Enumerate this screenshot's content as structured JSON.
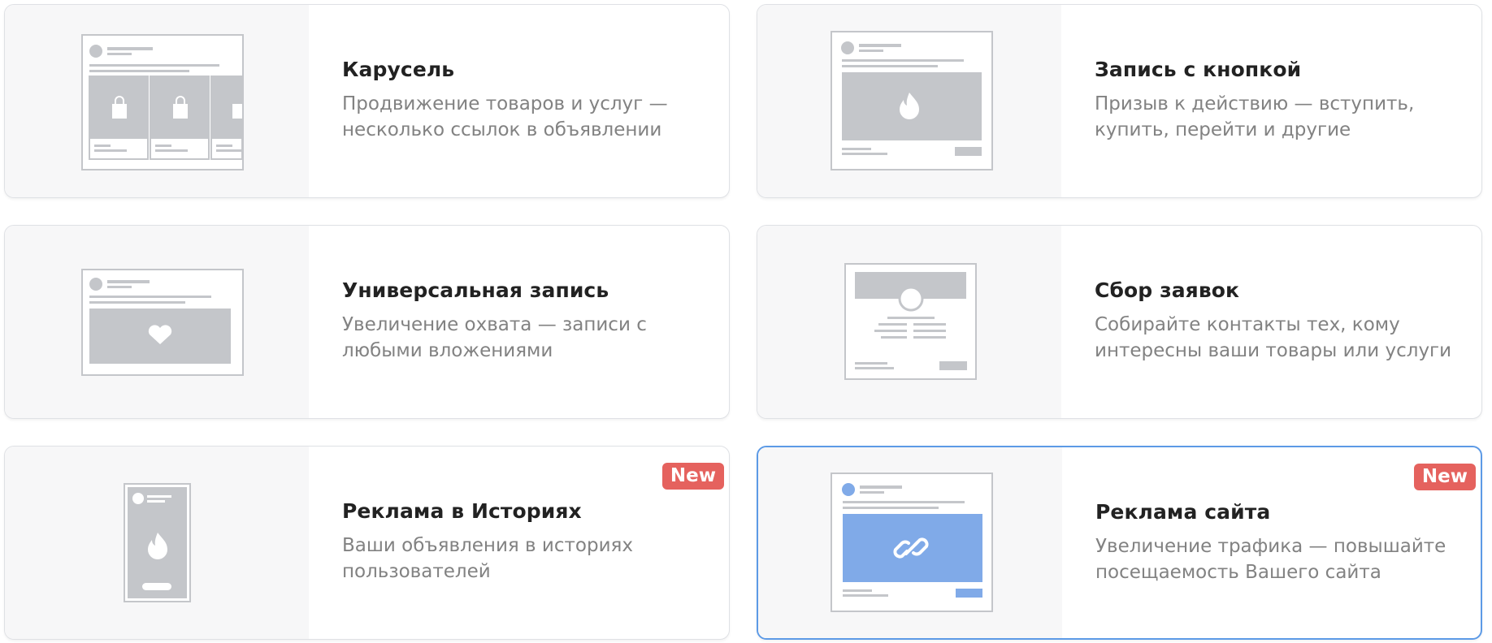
{
  "cards": [
    {
      "title": "Карусель",
      "description": "Продвижение товаров и услуг — несколько ссылок в объявлении",
      "badge": "",
      "selected": false,
      "icon": "carousel-preview-icon"
    },
    {
      "title": "Запись с кнопкой",
      "description": "Призыв к действию — вступить, купить, перейти и другие",
      "badge": "",
      "selected": false,
      "icon": "button-post-preview-icon"
    },
    {
      "title": "Универсальная запись",
      "description": "Увеличение охвата — записи с любыми вложениями",
      "badge": "",
      "selected": false,
      "icon": "universal-post-preview-icon"
    },
    {
      "title": "Сбор заявок",
      "description": "Собирайте контакты тех, кому интересны ваши товары или услуги",
      "badge": "",
      "selected": false,
      "icon": "lead-form-preview-icon"
    },
    {
      "title": "Реклама в Историях",
      "description": "Ваши объявления в историях пользователей",
      "badge": "New",
      "selected": false,
      "icon": "stories-preview-icon"
    },
    {
      "title": "Реклама сайта",
      "description": "Увеличение трафика — повышайте посещаемость Вашего сайта",
      "badge": "New",
      "selected": true,
      "icon": "website-ad-preview-icon"
    }
  ],
  "colors": {
    "placeholder": "#c4c6ca",
    "accent": "#80aae8",
    "badge": "#e5625e",
    "selected_border": "#5c9ae6"
  }
}
